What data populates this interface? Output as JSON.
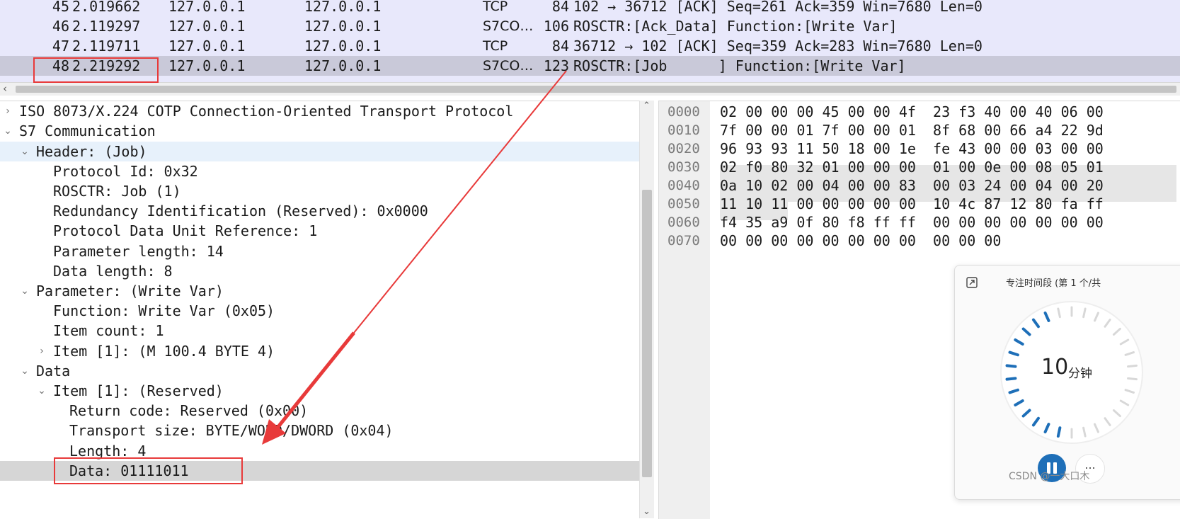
{
  "packet_list": {
    "rows": [
      {
        "no": "45",
        "time": "2.019662",
        "source": "127.0.0.1",
        "destination": "127.0.0.1",
        "protocol": "TCP",
        "length": "84",
        "info": "102 → 36712 [ACK] Seq=261 Ack=359 Win=7680 Len=0"
      },
      {
        "no": "46",
        "time": "2.119297",
        "source": "127.0.0.1",
        "destination": "127.0.0.1",
        "protocol": "S7CO…",
        "length": "106",
        "info": "ROSCTR:[Ack_Data] Function:[Write Var]"
      },
      {
        "no": "47",
        "time": "2.119711",
        "source": "127.0.0.1",
        "destination": "127.0.0.1",
        "protocol": "TCP",
        "length": "84",
        "info": "36712 → 102 [ACK] Seq=359 Ack=283 Win=7680 Len=0"
      },
      {
        "no": "48",
        "time": "2.219292",
        "source": "127.0.0.1",
        "destination": "127.0.0.1",
        "protocol": "S7CO…",
        "length": "123",
        "info": "ROSCTR:[Job      ] Function:[Write Var]"
      }
    ],
    "selected_no": "48"
  },
  "detail_tree": [
    {
      "label": "ISO 8073/X.224 COTP Connection-Oriented Transport Protocol",
      "expander": "›"
    },
    {
      "label": "S7 Communication",
      "expander": "⌄"
    },
    {
      "label": "Header: (Job)",
      "expander": "⌄"
    },
    {
      "label": "Protocol Id: 0x32",
      "expander": ""
    },
    {
      "label": "ROSCTR: Job (1)",
      "expander": ""
    },
    {
      "label": "Redundancy Identification (Reserved): 0x0000",
      "expander": ""
    },
    {
      "label": "Protocol Data Unit Reference: 1",
      "expander": ""
    },
    {
      "label": "Parameter length: 14",
      "expander": ""
    },
    {
      "label": "Data length: 8",
      "expander": ""
    },
    {
      "label": "Parameter: (Write Var)",
      "expander": "⌄"
    },
    {
      "label": "Function: Write Var (0x05)",
      "expander": ""
    },
    {
      "label": "Item count: 1",
      "expander": ""
    },
    {
      "label": "Item [1]: (M 100.4 BYTE 4)",
      "expander": "›"
    },
    {
      "label": "Data",
      "expander": "⌄"
    },
    {
      "label": "Item [1]: (Reserved)",
      "expander": "⌄"
    },
    {
      "label": "Return code: Reserved (0x00)",
      "expander": ""
    },
    {
      "label": "Transport size: BYTE/WORD/DWORD (0x04)",
      "expander": ""
    },
    {
      "label": "Length: 4",
      "expander": ""
    },
    {
      "label": "Data: 01111011",
      "expander": ""
    }
  ],
  "hex_dump": [
    {
      "offset": "0000",
      "bytes": "02 00 00 00 45 00 00 4f  23 f3 40 00 40 06 00"
    },
    {
      "offset": "0010",
      "bytes": "7f 00 00 01 7f 00 00 01  8f 68 00 66 a4 22 9d"
    },
    {
      "offset": "0020",
      "bytes": "96 93 93 11 50 18 00 1e  fe 43 00 00 03 00 00"
    },
    {
      "offset": "0030",
      "bytes": "02 f0 80 32 01 00 00 00  01 00 0e 00 08 05 01"
    },
    {
      "offset": "0040",
      "bytes": "0a 10 02 00 04 00 00 83  00 03 24 00 04 00 20"
    },
    {
      "offset": "0050",
      "bytes": "11 10 11 00 00 00 00 00  10 4c 87 12 80 fa ff"
    },
    {
      "offset": "0060",
      "bytes": "f4 35 a9 0f 80 f8 ff ff  00 00 00 00 00 00 00"
    },
    {
      "offset": "0070",
      "bytes": "00 00 00 00 00 00 00 00  00 00 00"
    }
  ],
  "focus_widget": {
    "title": "专注时间段 (第 1 个/共",
    "time_value": "10",
    "time_unit": "分钟",
    "more_label": "..."
  },
  "watermark": "CSDN @一大口木",
  "colors": {
    "packet_list_bg": "#e8e8fb",
    "selected_row": "#c9c9d9",
    "annotation_red": "#e83a3a",
    "timer_blue": "#1e6fb8"
  }
}
